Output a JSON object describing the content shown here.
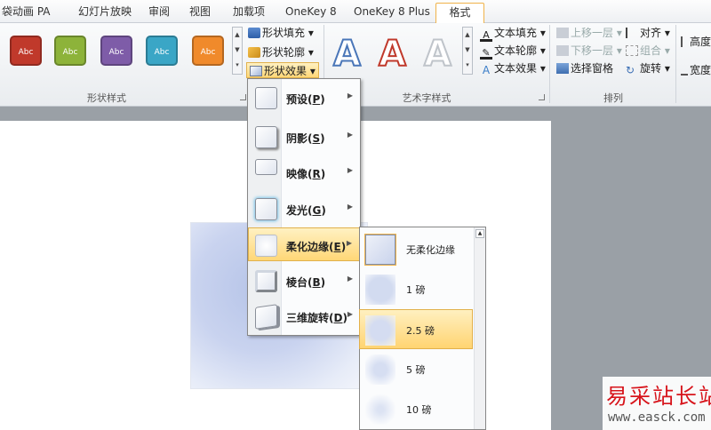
{
  "tabs": [
    {
      "label": "袋动画 PA"
    },
    {
      "label": "幻灯片放映"
    },
    {
      "label": "审阅"
    },
    {
      "label": "视图"
    },
    {
      "label": "加载项"
    },
    {
      "label": "OneKey 8"
    },
    {
      "label": "OneKey 8 Plus"
    },
    {
      "label": "格式",
      "active": true
    }
  ],
  "shape_styles": {
    "swatches": [
      {
        "label": "Abc",
        "color": "#c0392b"
      },
      {
        "label": "Abc",
        "color": "#8db33a"
      },
      {
        "label": "Abc",
        "color": "#7e5ca8"
      },
      {
        "label": "Abc",
        "color": "#3aa6c6"
      },
      {
        "label": "Abc",
        "color": "#f08a2b"
      }
    ],
    "fill_label": "形状填充",
    "outline_label": "形状轮廓",
    "effects_label": "形状效果",
    "group_label": "形状样式"
  },
  "wordart": {
    "samples": [
      {
        "letter": "A",
        "color": "#4a76b8"
      },
      {
        "letter": "A",
        "color": "#c0392b"
      },
      {
        "letter": "A",
        "color": "#bfc4ca"
      }
    ],
    "text_fill_label": "文本填充",
    "text_outline_label": "文本轮廓",
    "text_effects_label": "文本效果",
    "group_label": "艺术字样式"
  },
  "arrange": {
    "bring_forward": "上移一层",
    "send_backward": "下移一层",
    "selection_pane": "选择窗格",
    "align": "对齐",
    "group": "组合",
    "rotate": "旋转",
    "group_label": "排列"
  },
  "size": {
    "height_label": "高度",
    "width_label": "宽度"
  },
  "effects_menu": [
    {
      "label": "预设",
      "key": "P"
    },
    {
      "label": "阴影",
      "key": "S"
    },
    {
      "label": "映像",
      "key": "R"
    },
    {
      "label": "发光",
      "key": "G"
    },
    {
      "label": "柔化边缘",
      "key": "E",
      "highlighted": true
    },
    {
      "label": "棱台",
      "key": "B"
    },
    {
      "label": "三维旋转",
      "key": "D"
    }
  ],
  "soft_edges_menu": [
    {
      "label": "无柔化边缘"
    },
    {
      "label": "1 磅"
    },
    {
      "label": "2.5 磅",
      "highlighted": true
    },
    {
      "label": "5 磅"
    },
    {
      "label": "10 磅"
    }
  ],
  "watermark": {
    "title": "易采站长站",
    "url": "www.easck.com"
  }
}
